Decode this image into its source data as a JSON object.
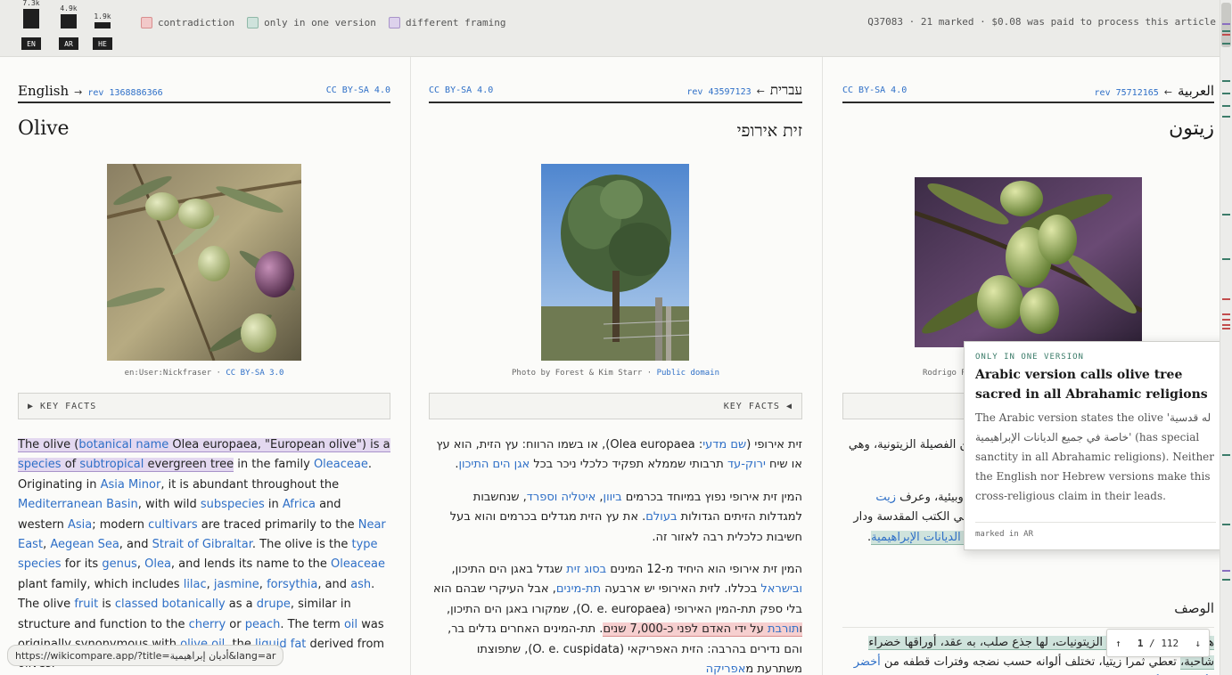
{
  "topbar": {
    "bars": [
      {
        "label": "EN",
        "value_text": "7.3k",
        "value": 7.3
      },
      {
        "label": "AR",
        "value_text": "4.9k",
        "value": 4.9
      },
      {
        "label": "HE",
        "value_text": "1.9k",
        "value": 1.9
      }
    ],
    "legend": {
      "contradiction": "contradiction",
      "one_version": "only in one version",
      "framing": "different framing"
    },
    "status": "Q37083 · 21 marked · $0.08 was paid to process this article"
  },
  "en": {
    "lang": "English",
    "arrow": "→",
    "rev": "rev 1368886366",
    "license": "CC BY-SA 4.0",
    "title": "Olive",
    "caption_author": "en:User:Nickfraser",
    "caption_sep": " · ",
    "caption_license": "CC BY-SA 3.0",
    "keyfacts": "▶ KEY FACTS"
  },
  "he": {
    "lang": "עברית",
    "arrow": "←",
    "rev": "rev 43597123",
    "license": "CC BY-SA 4.0",
    "title": "זית אירופי",
    "caption_author": "Photo by Forest & Kim Starr",
    "caption_sep": " · ",
    "caption_license": "Public domain",
    "keyfacts": "KEY FACTS ◀"
  },
  "ar": {
    "lang": "العربية",
    "arrow": "←",
    "rev": "rev 75712165",
    "license": "CC BY-SA 4.0",
    "title": "زيتون",
    "caption_author": "Rodrigo R",
    "subhead": "الوصف"
  },
  "tooltip": {
    "kind": "ONLY IN ONE VERSION",
    "title": "Arabic version calls olive tree sacred in all Abrahamic religions",
    "body": "The Arabic version states the olive 'له قدسية خاصة في جميع الديانات الإبراهيمية' (has special sanctity in all Abrahamic religions). Neither the English nor Hebrew versions make this cross-religious claim in their leads.",
    "foot": "marked in AR"
  },
  "pager": {
    "up": "↑",
    "current": "1",
    "sep": " / ",
    "total": "112",
    "down": "↓"
  },
  "url_preview": "https://wikicompare.app/?title=أديان إبراهيمية&lang=ar",
  "colors": {
    "contradiction": "#d98e8e",
    "one_version": "#8fb8a8",
    "framing": "#a893c9",
    "link": "#2e6fc7"
  }
}
